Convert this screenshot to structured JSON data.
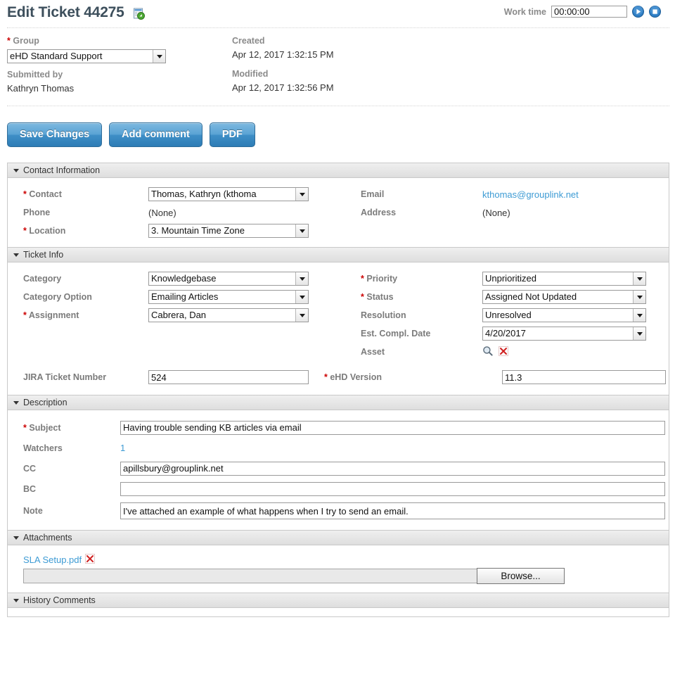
{
  "header": {
    "title": "Edit Ticket 44275",
    "title_icon": "refresh-window-icon",
    "worktime_label": "Work time",
    "worktime_value": "00:00:00",
    "play_icon": "play-icon",
    "stop_icon": "stop-icon"
  },
  "meta": {
    "group_label": "Group",
    "group_value": "eHD Standard Support",
    "submitted_by_label": "Submitted by",
    "submitted_by_value": "Kathryn Thomas",
    "created_label": "Created",
    "created_value": "Apr 12, 2017 1:32:15 PM",
    "modified_label": "Modified",
    "modified_value": "Apr 12, 2017 1:32:56 PM"
  },
  "toolbar": {
    "save_label": "Save Changes",
    "add_comment_label": "Add comment",
    "pdf_label": "PDF"
  },
  "sections": {
    "contact": {
      "title": "Contact Information",
      "contact_label": "Contact",
      "contact_value": "Thomas, Kathryn (kthoma",
      "phone_label": "Phone",
      "phone_value": "(None)",
      "location_label": "Location",
      "location_value": "3. Mountain Time Zone",
      "email_label": "Email",
      "email_value": "kthomas@grouplink.net",
      "address_label": "Address",
      "address_value": "(None)"
    },
    "ticket_info": {
      "title": "Ticket Info",
      "category_label": "Category",
      "category_value": "Knowledgebase",
      "category_option_label": "Category Option",
      "category_option_value": "Emailing Articles",
      "assignment_label": "Assignment",
      "assignment_value": "Cabrera, Dan",
      "priority_label": "Priority",
      "priority_value": "Unprioritized",
      "status_label": "Status",
      "status_value": "Assigned Not Updated",
      "resolution_label": "Resolution",
      "resolution_value": "Unresolved",
      "est_date_label": "Est. Compl. Date",
      "est_date_value": "4/20/2017",
      "asset_label": "Asset",
      "asset_search_icon": "magnifier-icon",
      "asset_clear_icon": "red-x-icon",
      "jira_label": "JIRA Ticket Number",
      "jira_value": "524",
      "ehd_version_label": "eHD Version",
      "ehd_version_value": "11.3"
    },
    "description": {
      "title": "Description",
      "subject_label": "Subject",
      "subject_value": "Having trouble sending KB articles via email",
      "watchers_label": "Watchers",
      "watchers_value": "1",
      "cc_label": "CC",
      "cc_value": "apillsbury@grouplink.net",
      "bc_label": "BC",
      "bc_value": "",
      "note_label": "Note",
      "note_value": "I've attached an example of what happens when I try to send an email."
    },
    "attachments": {
      "title": "Attachments",
      "file_name": "SLA Setup.pdf",
      "file_remove_icon": "red-x-icon",
      "browse_label": "Browse...",
      "file_input_value": ""
    },
    "history": {
      "title": "History Comments"
    }
  },
  "colors": {
    "accent_blue": "#3d9bd4",
    "required_red": "#cc0000",
    "title_color": "#3d4f5c",
    "label_gray": "#7b7b7b"
  }
}
